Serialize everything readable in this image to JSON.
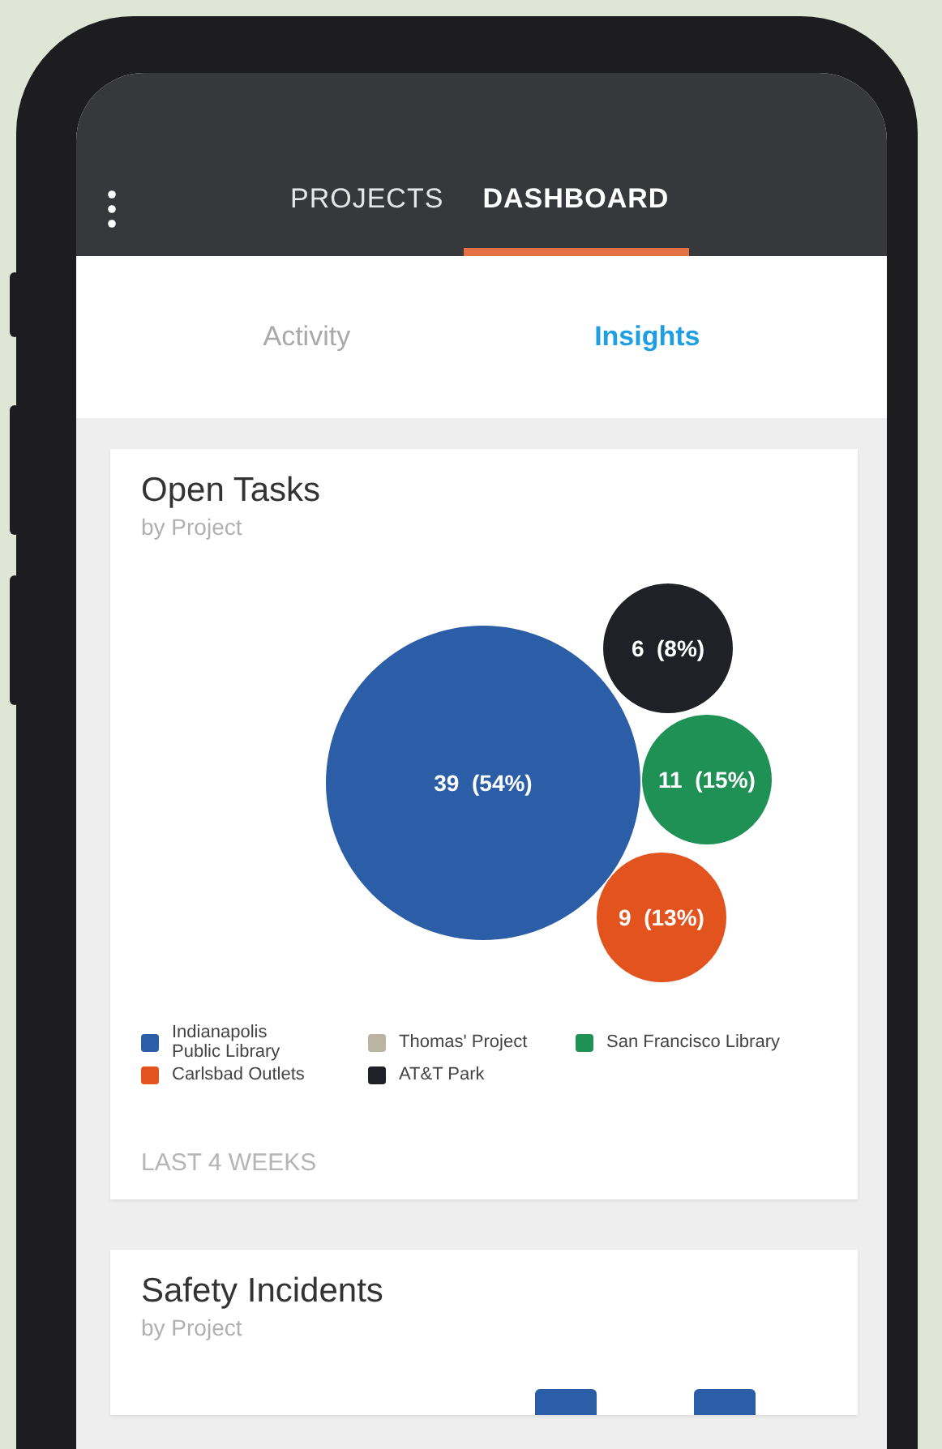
{
  "top_tabs": [
    {
      "label": "PROJECTS",
      "selected": false
    },
    {
      "label": "DASHBOARD",
      "selected": true
    }
  ],
  "sub_tabs": [
    {
      "label": "Activity",
      "selected": false
    },
    {
      "label": "Insights",
      "selected": true
    }
  ],
  "open_tasks": {
    "title": "Open Tasks",
    "subtitle": "by Project",
    "bubbles": [
      {
        "label": "39  (54%)",
        "color": "#2b5ea6"
      },
      {
        "label": "6  (8%)",
        "color": "#1f2126"
      },
      {
        "label": "11  (15%)",
        "color": "#1f9155"
      },
      {
        "label": "9  (13%)",
        "color": "#e2531d"
      }
    ],
    "legend": [
      {
        "label": "Indianapolis Public Library",
        "color": "#2b5ea6"
      },
      {
        "label": "Thomas' Project",
        "color": "#b9b5a2"
      },
      {
        "label": "San Francisco Library",
        "color": "#1f9155"
      },
      {
        "label": "Carlsbad Outlets",
        "color": "#e2531d"
      },
      {
        "label": "AT&T Park",
        "color": "#1f2126"
      }
    ],
    "period": "LAST 4 WEEKS"
  },
  "safety_incidents": {
    "title": "Safety Incidents",
    "subtitle": "by Project"
  }
}
